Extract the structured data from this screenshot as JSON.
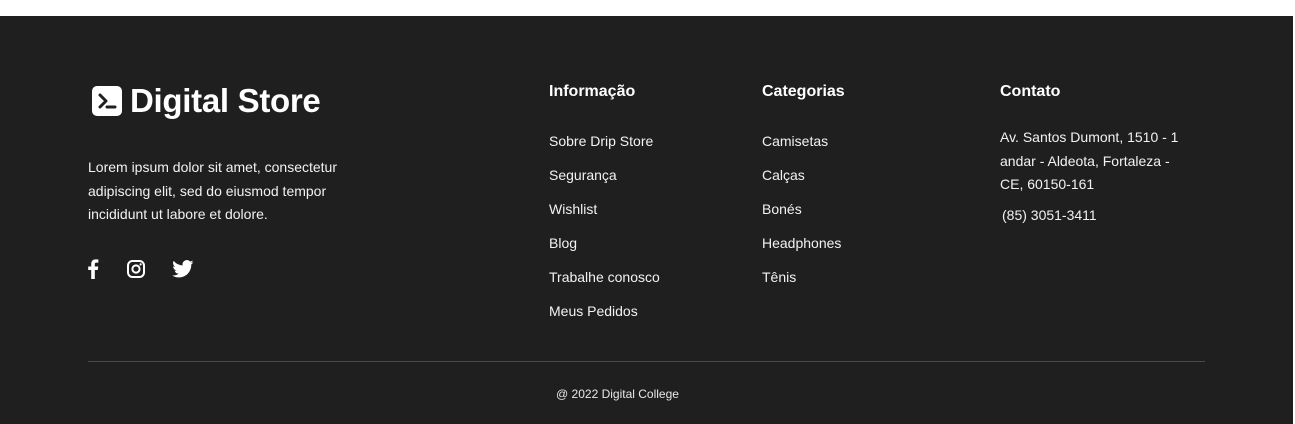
{
  "brand": {
    "logo_icon": "terminal-icon",
    "name": "Digital Store",
    "description": "Lorem ipsum dolor sit amet, consectetur adipiscing elit, sed do eiusmod tempor incididunt ut labore et dolore.",
    "social": [
      {
        "name": "facebook-icon"
      },
      {
        "name": "instagram-icon"
      },
      {
        "name": "twitter-icon"
      }
    ]
  },
  "info": {
    "title": "Informação",
    "links": [
      "Sobre Drip Store",
      "Segurança",
      "Wishlist",
      "Blog",
      "Trabalhe conosco",
      "Meus Pedidos"
    ]
  },
  "categories": {
    "title": "Categorias",
    "links": [
      "Camisetas",
      "Calças",
      "Bonés",
      "Headphones",
      "Tênis"
    ]
  },
  "contact": {
    "title": "Contato",
    "address_lines": [
      "Av. Santos Dumont, 1510 - 1",
      "andar - Aldeota, Fortaleza -",
      "CE, 60150-161"
    ],
    "phone": "(85) 3051-3411"
  },
  "copyright": "@ 2022 Digital College",
  "colors": {
    "footer_bg": "#1f1f1f",
    "text": "#ffffff",
    "divider": "#4a4a4a"
  }
}
